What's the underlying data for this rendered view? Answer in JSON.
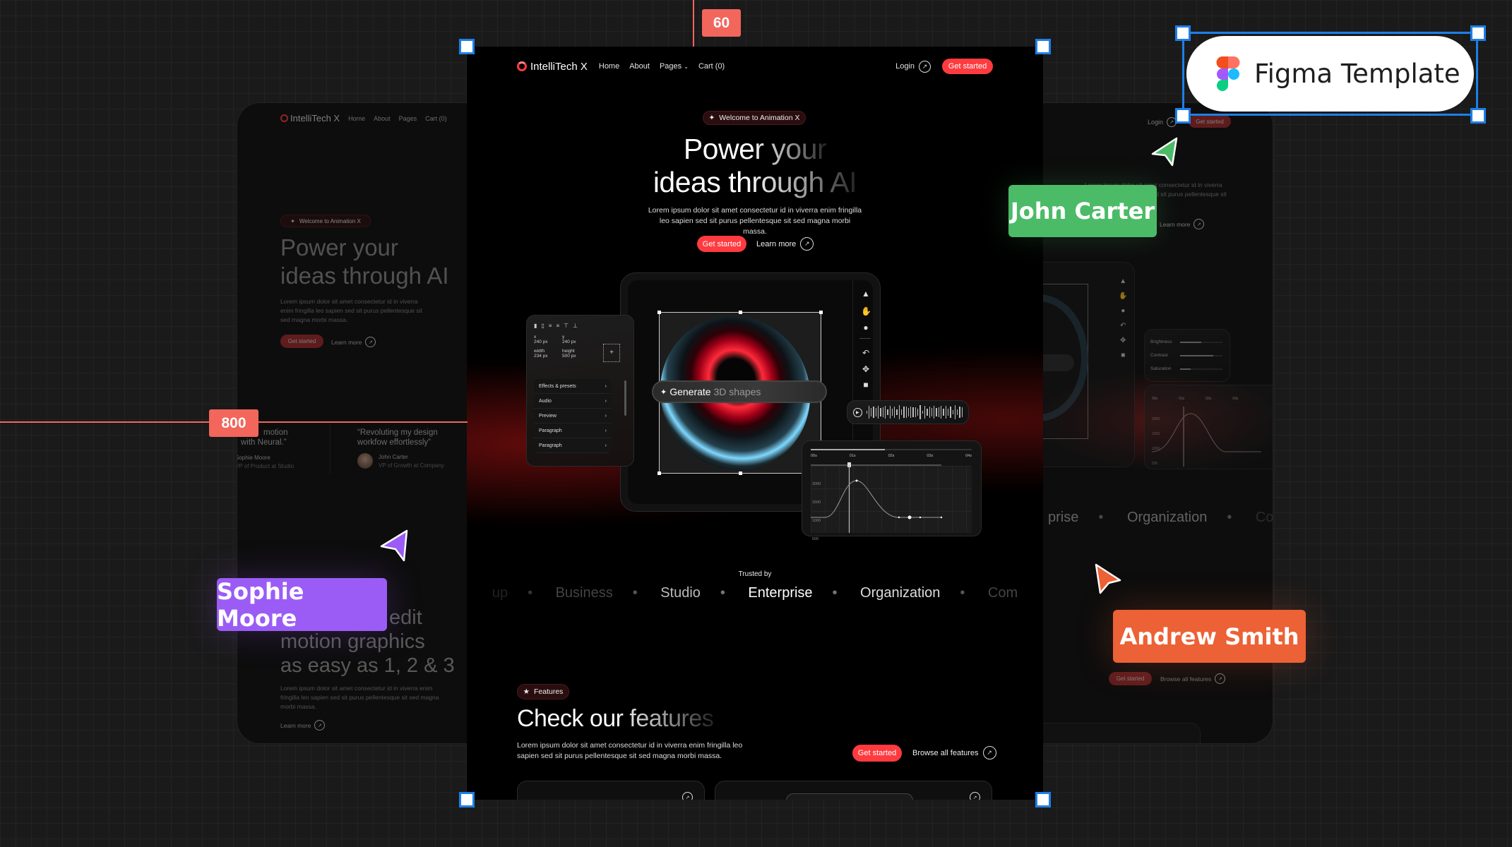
{
  "canvas": {
    "ruler_top_value": "60",
    "ruler_left_value": "800",
    "figma_badge": {
      "label": "Figma Template"
    },
    "collaborators": [
      {
        "name": "John Carter",
        "color": "#4cbb67"
      },
      {
        "name": "Sophie Moore",
        "color": "#9b5cf6"
      },
      {
        "name": "Andrew Smith",
        "color": "#ec6135"
      }
    ],
    "selection_color": "#1e7fe8",
    "ruler_color": "#f2665c"
  },
  "main": {
    "nav": {
      "brand": "IntelliTech X",
      "links": [
        "Home",
        "About",
        "Pages",
        "Cart (0)"
      ],
      "login": "Login",
      "cta": "Get started"
    },
    "hero": {
      "badge": "Welcome to Animation X",
      "title_line1": "Power your",
      "title_line2": "ideas through AI",
      "description": "Lorem ipsum dolor sit amet consectetur id in viverra enim fringilla leo sapien sed sit purus pellentesque sit sed magna morbi massa.",
      "primary_button": "Get started",
      "secondary_button": "Learn more"
    },
    "editor": {
      "props": {
        "x_label": "x",
        "x_value": "240 px",
        "y_label": "y",
        "y_value": "240 px",
        "width_label": "width",
        "width_value": "234 px",
        "height_label": "height",
        "height_value": "500 px"
      },
      "menu": [
        "Effects & presets",
        "Audio",
        "Preview",
        "Paragraph",
        "Paragraph"
      ],
      "prompt_bold": "Generate",
      "prompt_rest": " 3D shapes",
      "timeline": {
        "time_ticks": [
          "00s",
          "01s",
          "02s",
          "03s",
          "04s"
        ],
        "value_ticks": [
          "2000",
          "1500",
          "1000",
          "500"
        ]
      },
      "tools": [
        "pointer-icon",
        "hand-icon",
        "zoom-icon",
        "undo-icon",
        "move-icon",
        "video-icon"
      ]
    },
    "trusted": {
      "label": "Trusted by",
      "logos": [
        "up",
        "Business",
        "Studio",
        "Enterprise",
        "Organization",
        "Com"
      ]
    },
    "features": {
      "badge": "Features",
      "title": "Check our features",
      "description": "Lorem ipsum dolor sit amet consectetur id in viverra enim fringilla leo sapien sed sit purus pellentesque sit sed magna morbi massa.",
      "primary_button": "Get started",
      "secondary_button": "Browse all features"
    },
    "accent": "#ff3b3f"
  },
  "left_preview": {
    "brand": "IntelliTech X",
    "links": [
      "Home",
      "About",
      "Pages",
      "Cart (0)"
    ],
    "badge": "Welcome to Animation X",
    "title_line1": "Power your",
    "title_line2": "ideas through AI",
    "description": "Lorem ipsum dolor sit amet consectetur id in viverra enim fringilla leo sapien sed sit purus pellentesque sit sed magna morbi massa.",
    "primary_button": "Get started",
    "secondary_button": "Learn more",
    "testimonials": [
      {
        "quote_line1": "motion",
        "quote_line2": "with Neural.”",
        "name": "Sophie Moore",
        "role": "VP of Product at Studio"
      },
      {
        "quote_line1": "“Revoluting my design",
        "quote_line2": "workfow effortlessly”",
        "name": "John Carter",
        "role": "VP of Growth at Company"
      }
    ],
    "section_title": [
      "edit",
      "motion graphics",
      "as easy as 1, 2 & 3"
    ],
    "section_description": "Lorem ipsum dolor sit amet consectetur id in viverra enim fringilla leo sapien sed sit purus pellentesque sit sed magna morbi massa.",
    "section_link": "Learn more"
  },
  "right_preview": {
    "login": "Login",
    "cta": "Get started",
    "description_line1": "Lorem ipsum dolor sit amet consectetur id in viverra",
    "description_line2": "enim fringilla leo sapien sed sit purus pellentesque sit",
    "link": "Learn more",
    "sliders": [
      {
        "label": "Brightness",
        "level": 0.5
      },
      {
        "label": "Contrast",
        "level": 0.78
      },
      {
        "label": "Saturation",
        "level": 0.25
      }
    ],
    "timeline": {
      "time_ticks": [
        "00s",
        "01s",
        "02s",
        "03s"
      ],
      "value_ticks": [
        "2000",
        "1500",
        "1000",
        "500"
      ]
    },
    "logos": [
      "prise",
      "Organization",
      "Com"
    ],
    "primary_button": "Get started",
    "secondary_button": "Browse all features"
  }
}
